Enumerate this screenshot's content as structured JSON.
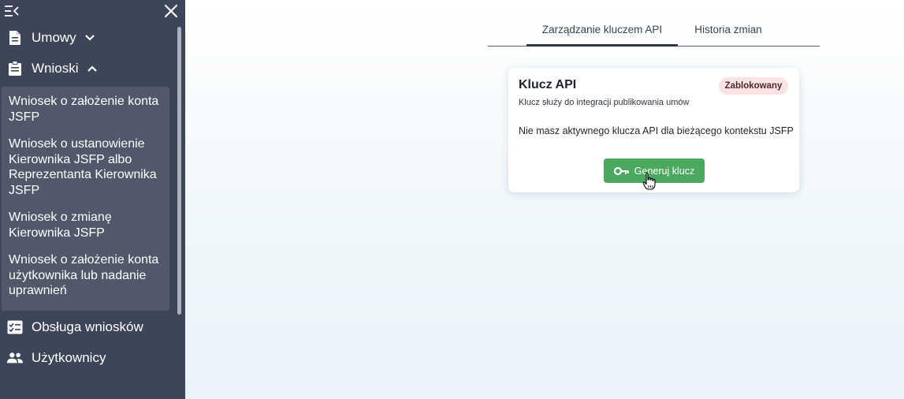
{
  "sidebar": {
    "collapse_icon": "menu-collapse-icon",
    "close_icon": "close-icon",
    "items": [
      {
        "label": "Umowy",
        "icon": "document-icon",
        "chevron": "chevron-down-icon"
      },
      {
        "label": "Wnioski",
        "icon": "clipboard-icon",
        "chevron": "chevron-up-icon"
      },
      {
        "label": "Obsługa wniosków",
        "icon": "checklist-icon"
      },
      {
        "label": "Użytkownicy",
        "icon": "users-icon"
      }
    ],
    "submenu": [
      {
        "label": "Wniosek o założenie konta JSFP"
      },
      {
        "label": "Wniosek o ustanowienie Kierownika JSFP albo Reprezentanta Kierownika JSFP"
      },
      {
        "label": "Wniosek o zmianę Kierownika JSFP"
      },
      {
        "label": "Wniosek o założenie konta użytkownika lub nadanie uprawnień"
      }
    ]
  },
  "tabs": [
    {
      "label": "Zarządzanie kluczem API",
      "active": true
    },
    {
      "label": "Historia zmian",
      "active": false
    }
  ],
  "card": {
    "title": "Klucz API",
    "badge": "Zablokowany",
    "subtitle": "Klucz służy do integracji publikowania umów",
    "message": "Nie masz aktywnego klucza API dla bieżącego kontekstu JSFP",
    "button_label": "Generuj klucz",
    "button_icon": "key-icon"
  },
  "colors": {
    "sidebar_bg": "#3d4558",
    "submenu_bg": "#50586a",
    "button_green": "#4aa85f",
    "badge_bg": "#fbe3e3"
  }
}
